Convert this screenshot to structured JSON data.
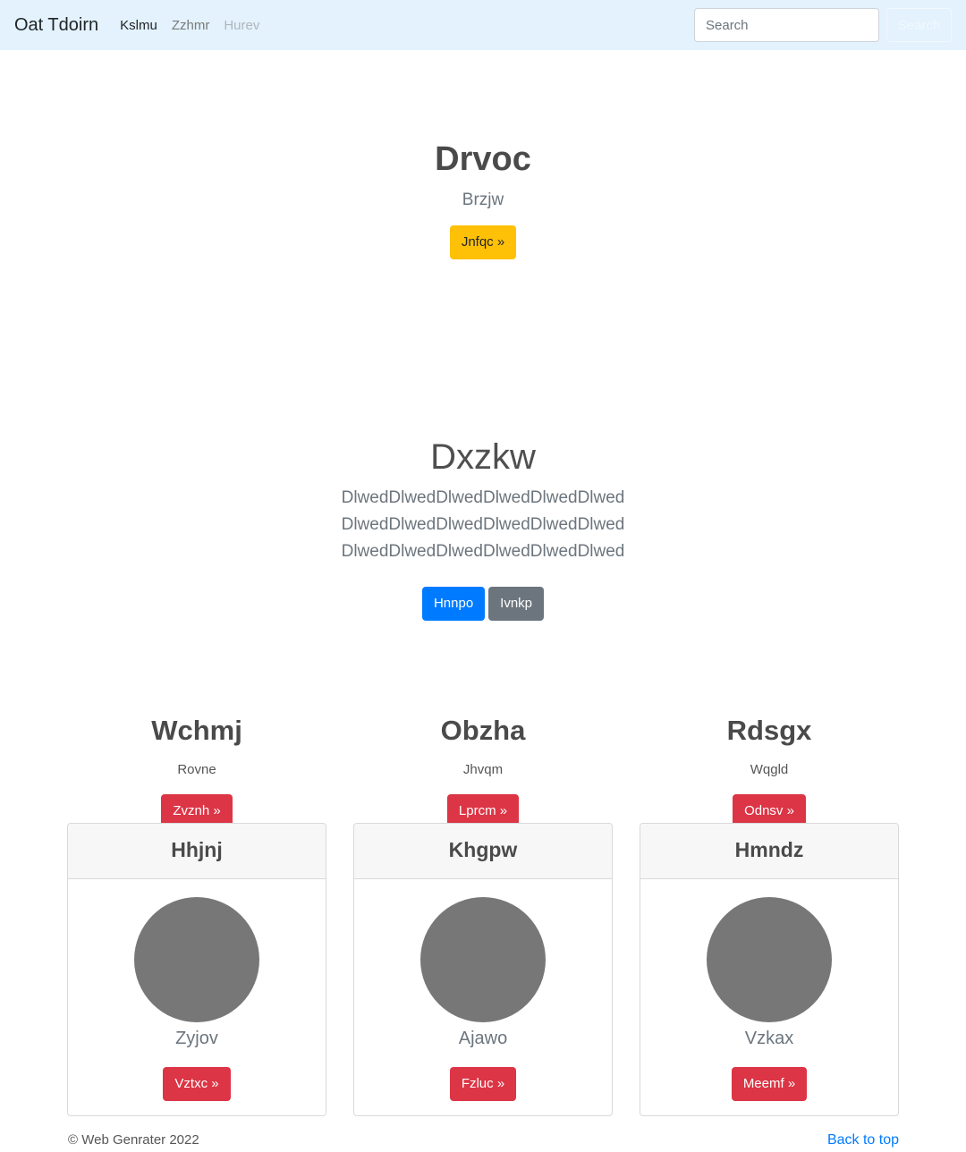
{
  "navbar": {
    "brand": "Oat Tdoirn",
    "links": [
      {
        "label": "Kslmu"
      },
      {
        "label": "Zzhmr"
      },
      {
        "label": "Hurev"
      }
    ],
    "search": {
      "placeholder": "Search",
      "button": "Search"
    },
    "background": "#e3f2fd"
  },
  "hero": {
    "title": "Drvoc",
    "subtitle": "Brzjw",
    "button": "Jnfqc »"
  },
  "section2": {
    "title": "Dxzkw",
    "text": "DlwedDlwedDlwedDlwedDlwedDlwedDlwedDlwedDlwedDlwedDlwedDlwedDlwedDlwedDlwedDlwedDlwedDlwed",
    "primary_button": "Hnnpo",
    "secondary_button": "Ivnkp"
  },
  "columns": [
    {
      "title": "Wchmj",
      "subtitle": "Rovne",
      "button": "Zvznh »"
    },
    {
      "title": "Obzha",
      "subtitle": "Jhvqm",
      "button": "Lprcm »"
    },
    {
      "title": "Rdsgx",
      "subtitle": "Wqgld",
      "button": "Odnsv »"
    }
  ],
  "cards": [
    {
      "header": "Hhjnj",
      "name": "Zyjov",
      "button": "Vztxc »"
    },
    {
      "header": "Khgpw",
      "name": "Ajawo",
      "button": "Fzluc »"
    },
    {
      "header": "Hmndz",
      "name": "Vzkax",
      "button": "Meemf »"
    }
  ],
  "footer": {
    "copyright": "© Web Genrater 2022",
    "back_to_top": "Back to top"
  },
  "colors": {
    "primary": "#007bff",
    "secondary": "#6c757d",
    "warning": "#ffc107",
    "danger": "#dc3545",
    "avatar": "#777777"
  }
}
